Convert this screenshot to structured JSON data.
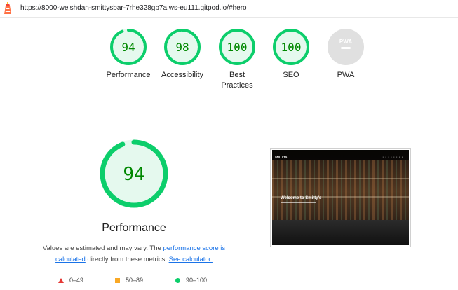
{
  "browser": {
    "url": "https://8000-welshdan-smittysbar-7rhe328gb7a.ws-eu111.gitpod.io/#hero"
  },
  "colors": {
    "pass": "#0cce6b",
    "pass_text": "#008800",
    "pass_fill": "#e5f9ee",
    "average": "#f9a825",
    "fail": "#e53935",
    "na": "#bdbdbd",
    "link": "#1a73e8"
  },
  "gauges": [
    {
      "id": "performance",
      "score": 94,
      "label": "Performance"
    },
    {
      "id": "accessibility",
      "score": 98,
      "label": "Accessibility"
    },
    {
      "id": "best-practices",
      "score": 100,
      "label": "Best Practices"
    },
    {
      "id": "seo",
      "score": 100,
      "label": "SEO"
    },
    {
      "id": "pwa",
      "score": null,
      "label": "PWA",
      "badge": "PWA"
    }
  ],
  "performance_detail": {
    "score": "94",
    "title": "Performance",
    "desc_prefix": "Values are estimated and may vary. The ",
    "link_perf_score": "performance score is calculated",
    "desc_middle": " directly from these metrics. ",
    "link_calculator": "See calculator."
  },
  "legend": [
    {
      "shape": "triangle",
      "range": "0–49"
    },
    {
      "shape": "square",
      "range": "50–89"
    },
    {
      "shape": "circle",
      "range": "90–100"
    }
  ],
  "screenshot": {
    "brand": "SMITTYS",
    "hero_text": "Welcome to Smitty's"
  }
}
